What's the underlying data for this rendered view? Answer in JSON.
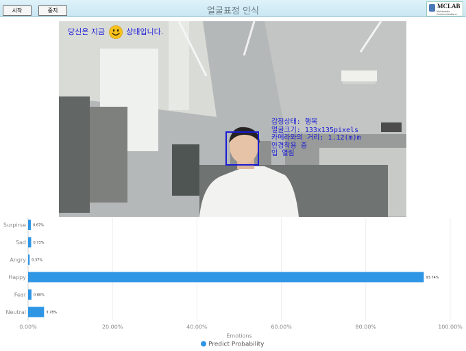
{
  "window": {
    "title": "얼굴표정 인식"
  },
  "toolbar": {
    "start_label": "시작",
    "stop_label": "중지"
  },
  "logo": {
    "text": "MCLAB",
    "subtext": "Multimedia Communications"
  },
  "status": {
    "prefix": "당신은 지금",
    "suffix": "상태입니다.",
    "icon": "smiley-face-icon"
  },
  "detection": {
    "lines": [
      "감정상태: 행복",
      "얼굴크기: 133x135pixels",
      "카메라와의 거리: 1.12(m)m",
      "안경착용 중",
      "입 열림"
    ]
  },
  "colors": {
    "bar": "#2f96e6",
    "text_overlay": "#1a1ad6",
    "title_bar": "#d6edf7"
  },
  "chart_data": {
    "type": "bar",
    "orientation": "horizontal",
    "categories": [
      "Surpirse",
      "Sad",
      "Angry",
      "Happy",
      "Fear",
      "Neutral"
    ],
    "series": [
      {
        "name": "Predict Probability",
        "values": [
          0.67,
          0.73,
          0.37,
          93.74,
          0.8,
          3.78
        ]
      }
    ],
    "data_labels": [
      "0.67%",
      "0.73%",
      "0.37%",
      "93.74%",
      "0.80%",
      "3.78%"
    ],
    "xlabel": "Emotions",
    "xlim": [
      0,
      100
    ],
    "xticks": [
      "0.00%",
      "20.00%",
      "40.00%",
      "60.00%",
      "80.00%",
      "100.00%"
    ],
    "grid": true,
    "legend_position": "bottom"
  }
}
